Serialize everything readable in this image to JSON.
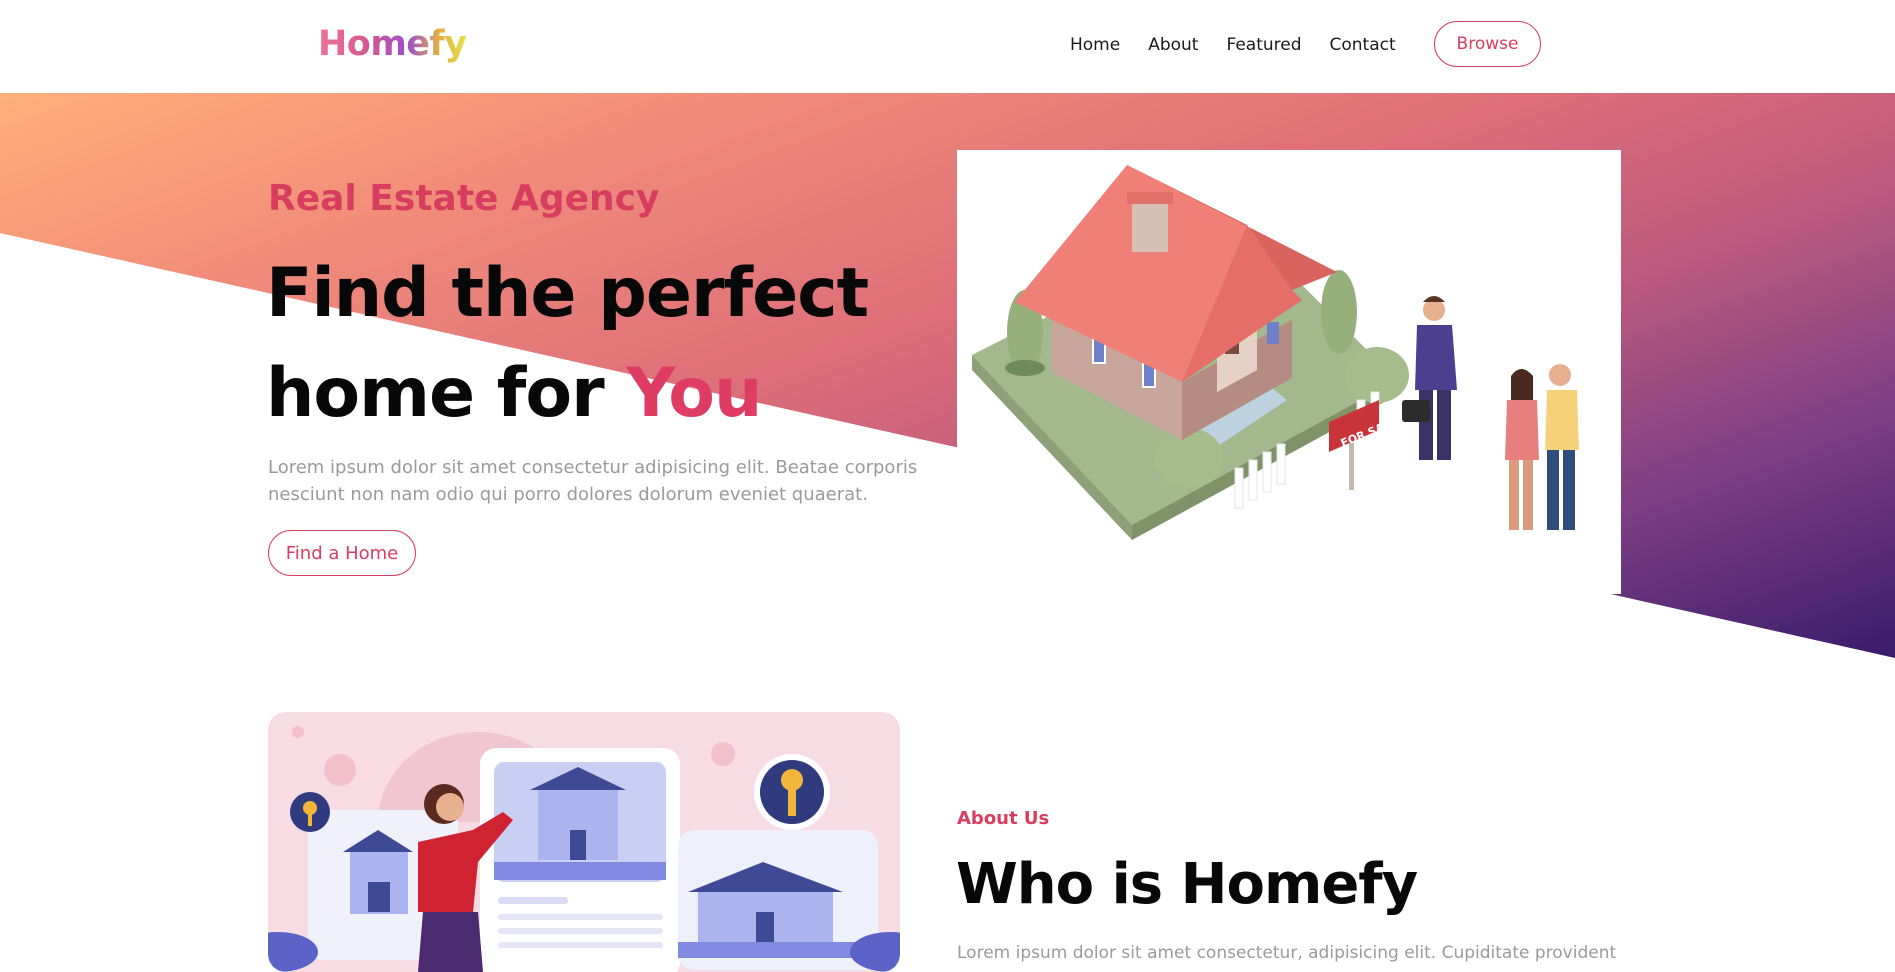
{
  "brand": {
    "logo": "Homefy"
  },
  "nav": {
    "items": [
      "Home",
      "About",
      "Featured",
      "Contact"
    ],
    "browse_label": "Browse"
  },
  "hero": {
    "eyebrow": "Real Estate Agency",
    "headline_line1": "Find the perfect",
    "headline_line2_prefix": "home for ",
    "headline_accent": "You",
    "lead": "Lorem ipsum dolor sit amet consectetur adipisicing elit. Beatae corporis nesciunt non nam odio qui porro dolores dolorum eveniet quaerat.",
    "cta_label": "Find a Home",
    "sign_text": "FOR SALE"
  },
  "about": {
    "eyebrow": "About Us",
    "title": "Who is Homefy",
    "text": "Lorem ipsum dolor sit amet consectetur, adipisicing elit. Cupiditate provident"
  },
  "colors": {
    "accent": "#d83d5f",
    "gradient_start": "#ffb07a",
    "gradient_end": "#3a1b6b",
    "muted_text": "#9a9a9a"
  }
}
